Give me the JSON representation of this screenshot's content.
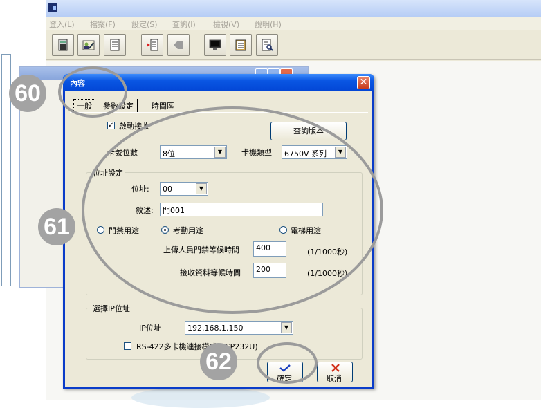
{
  "menu": [
    "登入(L)",
    "檔案(F)",
    "設定(S)",
    "查詢(I)",
    "檢視(V)",
    "說明(H)"
  ],
  "toolbar_icons": [
    "calculator-icon",
    "user-pen-icon",
    "document-icon",
    "import-icon",
    "arrow-icon",
    "monitor-icon",
    "clipboard-icon",
    "report-icon"
  ],
  "dialog": {
    "title": "內容",
    "close_symbol": "✕",
    "tabs": [
      "一般",
      "參數設定",
      "時間區"
    ],
    "enable_receive": {
      "label": "啟動接收",
      "checked": true
    },
    "query_version_label": "查詢版本",
    "card_digits": {
      "label": "卡號位數",
      "value": "8位"
    },
    "reader_type": {
      "label": "卡機類型",
      "value": "6750V 系列"
    },
    "address_group": {
      "legend": "位址設定",
      "address_label": "位址:",
      "address_value": "00",
      "description_label": "敘述:",
      "description_value": "門001",
      "usage_options": [
        {
          "label": "門禁用途",
          "selected": false
        },
        {
          "label": "考勤用途",
          "selected": true
        },
        {
          "label": "電梯用途",
          "selected": false
        }
      ],
      "upload_wait_label": "上傳人員門禁等候時間",
      "upload_wait_value": "400",
      "upload_wait_unit": "(1/1000秒)",
      "receive_wait_label": "接收資料等候時間",
      "receive_wait_value": "200",
      "receive_wait_unit": "(1/1000秒)"
    },
    "ip_group": {
      "legend": "選擇IP位址",
      "ip_label": "IP位址",
      "ip_value": "192.168.1.150",
      "rs422_label": "RS-422多卡機連接模式(RCP232U)",
      "rs422_checked": false
    },
    "ok_label": "確定",
    "cancel_label": "取消"
  },
  "callouts": [
    "60",
    "61",
    "62"
  ],
  "colors": {
    "ring": "#9b9b9b",
    "badge": "#a3a3a3",
    "dialog_title": "#0a56e3",
    "ok_check": "#1a3fbf",
    "cancel_x": "#d2311a"
  }
}
